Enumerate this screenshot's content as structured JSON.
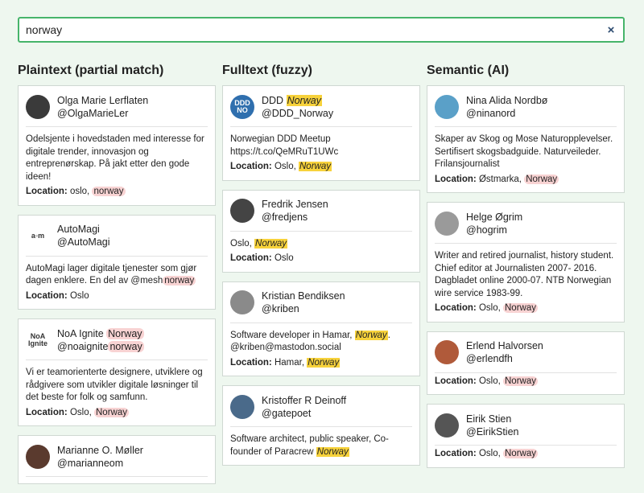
{
  "search": {
    "value": "norway",
    "clear_label": "×"
  },
  "columns": [
    {
      "title": "Plaintext (partial match)"
    },
    {
      "title": "Fulltext (fuzzy)"
    },
    {
      "title": "Semantic (AI)"
    }
  ],
  "location_label": "Location:",
  "plaintext": [
    {
      "name": "Olga Marie Lerflaten",
      "handle": "@OlgaMarieLer",
      "bio": "Odelsjente i hovedstaden med interesse for digitale trender, innovasjon og entreprenørskap. På jakt etter den gode ideen!",
      "loc_pre": "oslo, ",
      "loc_hl": "norway",
      "avatar_color": "#3a3a3a"
    },
    {
      "name": "AutoMagi",
      "handle": "@AutoMagi",
      "bio_pre": "AutoMagi lager digitale tjenester som gjør dagen enklere. En del av @mesh",
      "bio_hl": "norway",
      "loc_pre": "Oslo",
      "avatar_text": "a◦m",
      "avatar_color": "#ffffff"
    },
    {
      "name_pre": "NoA Ignite ",
      "name_hl": "Norway",
      "handle_pre": "@noaignite",
      "handle_hl": "norway",
      "bio": "Vi er teamorienterte designere, utviklere og rådgivere som utvikler digitale løsninger til det beste for folk og samfunn.",
      "loc_pre": "Oslo, ",
      "loc_hl": "Norway",
      "avatar_text": "NoA Ignite",
      "avatar_color": "#ffffff"
    },
    {
      "name": "Marianne O. Møller",
      "handle": "@marianneom",
      "avatar_color": "#5a3a2e"
    }
  ],
  "fulltext": [
    {
      "name_pre": "DDD ",
      "name_hl": "Norway",
      "handle": "@DDD_Norway",
      "bio": "Norwegian DDD Meetup https://t.co/QeMRuT1UWc",
      "loc_pre": "Oslo, ",
      "loc_hl": "Norway",
      "avatar_text": "DDD NO",
      "avatar_color": "#2f6fae"
    },
    {
      "name": "Fredrik Jensen",
      "handle": "@fredjens",
      "bio_pre": "Oslo, ",
      "bio_hl": "Norway",
      "loc_pre": "Oslo",
      "avatar_color": "#444444"
    },
    {
      "name": "Kristian Bendiksen",
      "handle": "@kriben",
      "bio_pre": "Software developer in Hamar, ",
      "bio_hl": "Norway",
      "bio_post": ". @kriben@mastodon.social",
      "loc_pre": "Hamar, ",
      "loc_hl": "Norway",
      "avatar_color": "#8a8a8a"
    },
    {
      "name": "Kristoffer R Deinoff",
      "handle": "@gatepoet",
      "bio_pre": "Software architect, public speaker, Co-founder of Paracrew ",
      "bio_hl": "Norway",
      "avatar_color": "#4a6a8a"
    }
  ],
  "semantic": [
    {
      "name": "Nina Alida Nordbø",
      "handle": "@ninanord",
      "bio": "Skaper av Skog og Mose Naturopplevelser. Sertifisert skogsbadguide. Naturveileder. Frilansjournalist",
      "loc_pre": "Østmarka, ",
      "loc_hl": "Norway",
      "avatar_color": "#5aa0c8"
    },
    {
      "name": "Helge Øgrim",
      "handle": "@hogrim",
      "bio": "Writer and retired journalist, history student. Chief editor at Journalisten 2007- 2016. Dagbladet online 2000-07. NTB Norwegian wire service 1983-99.",
      "loc_pre": "Oslo, ",
      "loc_hl": "Norway",
      "avatar_color": "#9a9a9a"
    },
    {
      "name": "Erlend Halvorsen",
      "handle": "@erlendfh",
      "loc_pre": "Oslo, ",
      "loc_hl": "Norway",
      "avatar_color": "#b05a3a"
    },
    {
      "name": "Eirik Stien",
      "handle": "@EirikStien",
      "loc_pre": "Oslo, ",
      "loc_hl": "Norway",
      "avatar_color": "#555555"
    }
  ]
}
